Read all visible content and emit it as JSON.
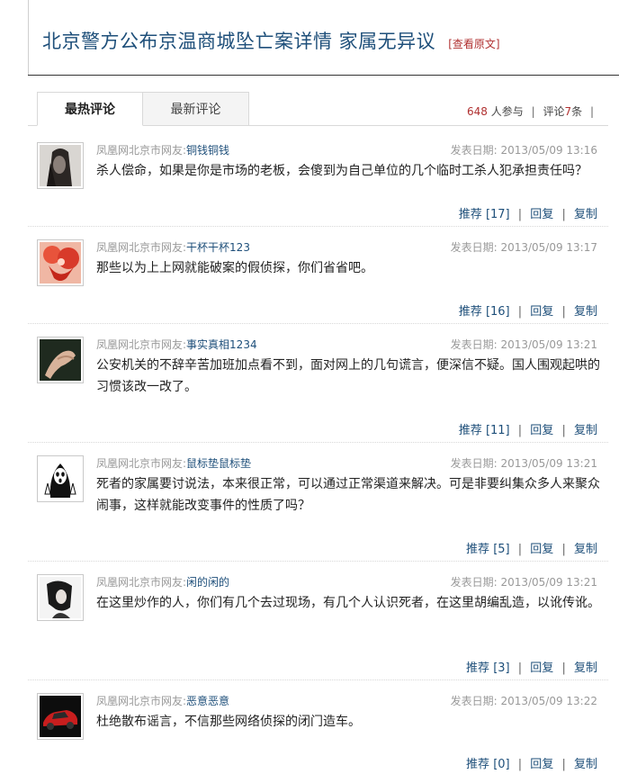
{
  "article": {
    "title": "北京警方公布京温商城坠亡案详情 家属无异议",
    "view_original": "[查看原文]"
  },
  "tabs": [
    {
      "label": "最热评论"
    },
    {
      "label": "最新评论"
    }
  ],
  "stats": {
    "participants": "648",
    "participants_suffix": "人参与",
    "comments_prefix": "评论",
    "comments": "7",
    "comments_suffix": "条"
  },
  "labels": {
    "user_prefix": "凤凰网北京市网友:",
    "date_prefix": "发表日期:",
    "recommend": "推荐",
    "reply": "回复",
    "copy": "复制"
  },
  "comments": [
    {
      "nickname": "铜钱铜钱",
      "date": "2013/05/09 13:16",
      "text": "杀人偿命，如果是你是市场的老板，会傻到为自己单位的几个临时工杀人犯承担责任吗？",
      "votes": "[17]",
      "avatar_icon": "woman-portrait-avatar"
    },
    {
      "nickname": "干杯干杯123",
      "date": "2013/05/09 13:17",
      "text": "那些以为上上网就能破案的假侦探，你们省省吧。",
      "votes": "[16]",
      "avatar_icon": "red-heart-avatar"
    },
    {
      "nickname": "事实真相1234",
      "date": "2013/05/09 13:21",
      "text": "公安机关的不辞辛苦加班加点看不到，面对网上的几句谎言，便深信不疑。国人围观起哄的习惯该改一改了。",
      "votes": "[11]",
      "avatar_icon": "hand-avatar"
    },
    {
      "nickname": "鼠标垫鼠标垫",
      "date": "2013/05/09 13:21",
      "text": "死者的家属要讨说法，本来很正常，可以通过正常渠道来解决。可是非要纠集众多人来聚众闹事，这样就能改变事件的性质了吗？",
      "votes": "[5]",
      "avatar_icon": "cartoon-mask-avatar"
    },
    {
      "nickname": "闲的闲的",
      "date": "2013/05/09 13:21",
      "text": "在这里炒作的人，你们有几个去过现场，有几个人认识死者，在这里胡编乱造，以讹传讹。",
      "votes": "[3]",
      "avatar_icon": "girl-sketch-avatar"
    },
    {
      "nickname": "恶意恶意",
      "date": "2013/05/09 13:22",
      "text": "杜绝散布谣言，不信那些网络侦探的闭门造车。",
      "votes": "[0]",
      "avatar_icon": "red-car-avatar"
    }
  ]
}
